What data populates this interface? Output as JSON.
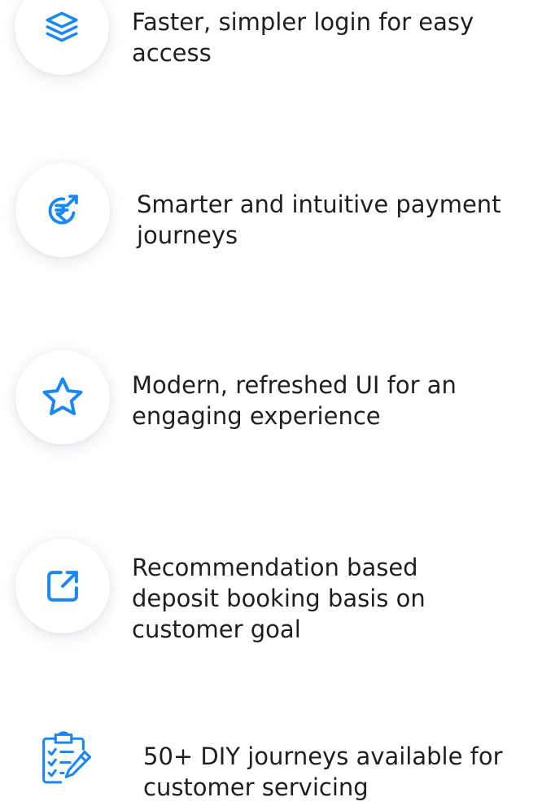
{
  "features": [
    {
      "text": "Faster, simpler login for easy access",
      "icon": "layers-icon"
    },
    {
      "text": "Smarter and intuitive payment journeys",
      "icon": "rupee-payment-icon"
    },
    {
      "text": "Modern, refreshed UI for an engaging experience",
      "icon": "star-icon"
    },
    {
      "text": "Recommendation based deposit booking basis on customer goal",
      "icon": "external-link-icon"
    },
    {
      "text": "50+ DIY journeys available for customer servicing",
      "icon": "clipboard-checklist-icon"
    }
  ],
  "colors": {
    "accent": "#1a88f2",
    "text": "#1f1f1f",
    "background": "#ffffff"
  }
}
